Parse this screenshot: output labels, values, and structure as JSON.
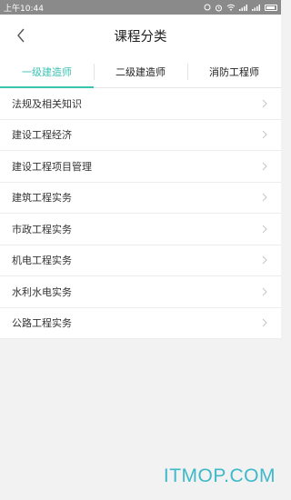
{
  "statusbar": {
    "time": "上午10:44",
    "battery_icon": "battery-icon",
    "wifi_icon": "wifi-icon",
    "signal_icon": "signal-icon",
    "alarm_icon": "alarm-icon"
  },
  "header": {
    "title": "课程分类",
    "back_icon": "chevron-left-icon"
  },
  "tabs": [
    {
      "label": "一级建造师",
      "active": true
    },
    {
      "label": "二级建造师",
      "active": false
    },
    {
      "label": "消防工程师",
      "active": false
    }
  ],
  "categories": [
    {
      "label": "法规及相关知识"
    },
    {
      "label": "建设工程经济"
    },
    {
      "label": "建设工程项目管理"
    },
    {
      "label": "建筑工程实务"
    },
    {
      "label": "市政工程实务"
    },
    {
      "label": "机电工程实务"
    },
    {
      "label": "水利水电实务"
    },
    {
      "label": "公路工程实务"
    }
  ],
  "watermark": "ITMOP.COM",
  "colors": {
    "accent": "#3cc2b3",
    "watermark": "#3db9c9",
    "statusbar": "#8a8a8a"
  }
}
